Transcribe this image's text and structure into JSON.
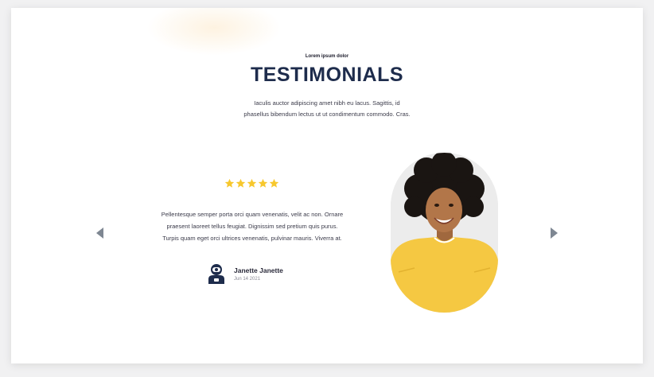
{
  "section": {
    "eyebrow": "Lorem ipsum dolor",
    "title": "TESTIMONIALS",
    "intro_line1": "Iaculis auctor adipiscing amet nibh eu lacus. Sagittis, id",
    "intro_line2": "phasellus bibendum lectus ut ut condimentum commodo. Cras."
  },
  "testimonial": {
    "rating": 5,
    "rating_max": 5,
    "star_color": "#f7c82e",
    "quote_line1": "Pellentesque semper porta orci quam venenatis, velit ac non. Ornare",
    "quote_line2": "praesent laoreet tellus feugiat. Dignissim sed pretium quis purus.",
    "quote_line3": "Turpis quam eget orci ultrices venenatis, pulvinar mauris. Viverra at.",
    "author_name": "Janette Janette",
    "author_date": "Jun 14 2021",
    "avatar_icon": "astronaut-avatar-icon",
    "photo_icon": "portrait-photo"
  },
  "nav": {
    "prev_icon": "chevron-left-icon",
    "next_icon": "chevron-right-icon",
    "arrow_color": "#7e8792"
  },
  "colors": {
    "title": "#1e2c4c",
    "sweater": "#f5c842"
  }
}
